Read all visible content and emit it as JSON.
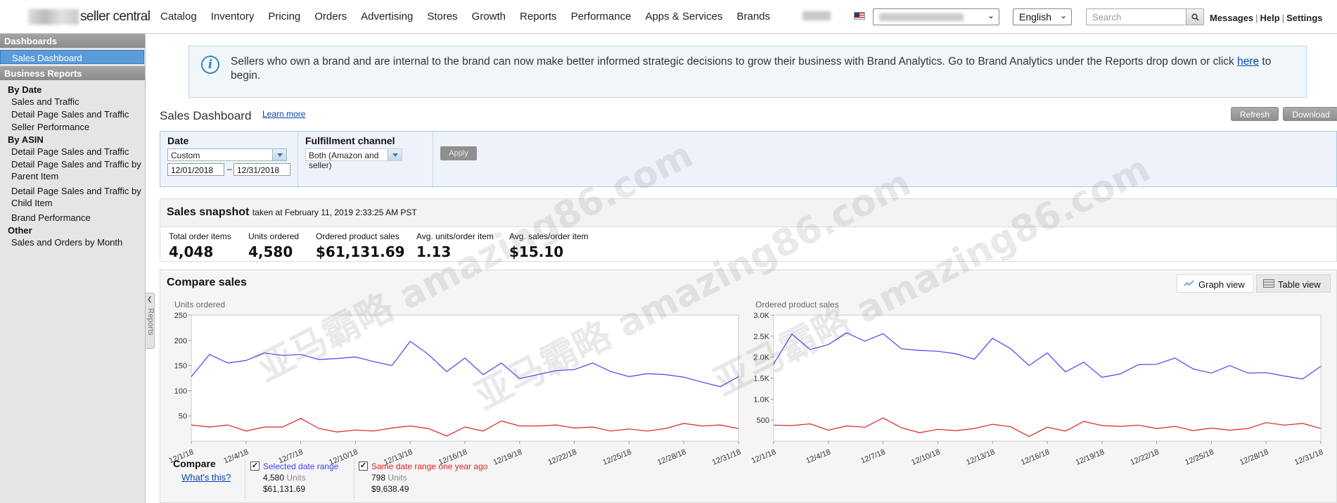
{
  "header": {
    "logo_text": "seller central",
    "nav": [
      "Catalog",
      "Inventory",
      "Pricing",
      "Orders",
      "Advertising",
      "Stores",
      "Growth",
      "Reports",
      "Performance",
      "Apps & Services",
      "Brands"
    ],
    "language": "English",
    "search_placeholder": "Search",
    "links": [
      "Messages",
      "Help",
      "Settings"
    ]
  },
  "sidebar": {
    "dashboards_heading": "Dashboards",
    "active_item": "Sales Dashboard",
    "reports_heading": "Business Reports",
    "groups": [
      {
        "title": "By Date",
        "items": [
          "Sales and Traffic",
          "Detail Page Sales and Traffic",
          "Seller Performance"
        ]
      },
      {
        "title": "By ASIN",
        "items": [
          "Detail Page Sales and Traffic",
          "Detail Page Sales and Traffic by Parent Item",
          "Detail Page Sales and Traffic by Child Item",
          "Brand Performance"
        ]
      },
      {
        "title": "Other",
        "items": [
          "Sales and Orders by Month"
        ]
      }
    ],
    "reports_tab": "Reports"
  },
  "banner": {
    "text": "Sellers who own a brand and are internal to the brand can now make better informed strategic decisions to grow their business with Brand Analytics. Go to Brand Analytics under the Reports drop down or click ",
    "link": "here",
    "text_end": " to begin."
  },
  "dashboard": {
    "title": "Sales Dashboard",
    "learn_more": "Learn more",
    "refresh": "Refresh",
    "download": "Download"
  },
  "filters": {
    "date_label": "Date",
    "date_range": "Custom",
    "date_from": "12/01/2018",
    "date_sep": "–",
    "date_to": "12/31/2018",
    "channel_label": "Fulfillment channel",
    "channel_value": "Both (Amazon and seller)",
    "apply": "Apply"
  },
  "snapshot": {
    "title": "Sales snapshot",
    "taken": "taken at February 11, 2019 2:33:25 AM PST",
    "metrics": [
      {
        "label": "Total order items",
        "value": "4,048"
      },
      {
        "label": "Units ordered",
        "value": "4,580"
      },
      {
        "label": "Ordered product sales",
        "value": "$61,131.69"
      },
      {
        "label": "Avg. units/order item",
        "value": "1.13"
      },
      {
        "label": "Avg. sales/order item",
        "value": "$15.10"
      }
    ]
  },
  "compare": {
    "title": "Compare sales",
    "graph_view": "Graph view",
    "table_view": "Table view",
    "compare_label": "Compare",
    "whats_this": "What's this?",
    "selected": {
      "label": "Selected date range",
      "units": "4,580",
      "units_word": "Units",
      "sales": "$61,131.69"
    },
    "last_year": {
      "label": "Same date range one year ago",
      "units": "798",
      "units_word": "Units",
      "sales": "$9,638.49"
    }
  },
  "colors": {
    "selected": "#4444ee",
    "last_year": "#dd2222"
  },
  "chart_data": [
    {
      "type": "line",
      "title": "Units ordered",
      "x": [
        "12/1/18",
        "12/2/18",
        "12/3/18",
        "12/4/18",
        "12/5/18",
        "12/6/18",
        "12/7/18",
        "12/8/18",
        "12/9/18",
        "12/10/18",
        "12/11/18",
        "12/12/18",
        "12/13/18",
        "12/14/18",
        "12/15/18",
        "12/16/18",
        "12/17/18",
        "12/18/18",
        "12/19/18",
        "12/20/18",
        "12/21/18",
        "12/22/18",
        "12/23/18",
        "12/24/18",
        "12/25/18",
        "12/26/18",
        "12/27/18",
        "12/28/18",
        "12/29/18",
        "12/30/18",
        "12/31/18"
      ],
      "tick_labels": [
        "12/1/18",
        "12/4/18",
        "12/7/18",
        "12/10/18",
        "12/13/18",
        "12/16/18",
        "12/19/18",
        "12/22/18",
        "12/25/18",
        "12/28/18",
        "12/31/18"
      ],
      "ylim": [
        0,
        250
      ],
      "yticks": [
        50,
        100,
        150,
        200,
        250
      ],
      "series": [
        {
          "name": "Selected date range",
          "values": [
            128,
            172,
            155,
            160,
            175,
            170,
            172,
            162,
            164,
            167,
            158,
            150,
            198,
            172,
            138,
            165,
            132,
            155,
            124,
            132,
            140,
            142,
            155,
            138,
            128,
            134,
            132,
            127,
            117,
            108,
            128
          ]
        },
        {
          "name": "Same date range one year ago",
          "values": [
            32,
            28,
            32,
            20,
            28,
            28,
            45,
            25,
            18,
            22,
            20,
            26,
            30,
            25,
            10,
            28,
            20,
            40,
            30,
            30,
            32,
            26,
            28,
            20,
            24,
            20,
            25,
            35,
            30,
            32,
            25
          ]
        }
      ]
    },
    {
      "type": "line",
      "title": "Ordered product sales",
      "x": [
        "12/1/18",
        "12/2/18",
        "12/3/18",
        "12/4/18",
        "12/5/18",
        "12/6/18",
        "12/7/18",
        "12/8/18",
        "12/9/18",
        "12/10/18",
        "12/11/18",
        "12/12/18",
        "12/13/18",
        "12/14/18",
        "12/15/18",
        "12/16/18",
        "12/17/18",
        "12/18/18",
        "12/19/18",
        "12/20/18",
        "12/21/18",
        "12/22/18",
        "12/23/18",
        "12/24/18",
        "12/25/18",
        "12/26/18",
        "12/27/18",
        "12/28/18",
        "12/29/18",
        "12/30/18",
        "12/31/18"
      ],
      "tick_labels": [
        "12/1/18",
        "12/4/18",
        "12/7/18",
        "12/10/18",
        "12/13/18",
        "12/16/18",
        "12/19/18",
        "12/22/18",
        "12/25/18",
        "12/28/18",
        "12/31/18"
      ],
      "ylim": [
        0,
        3000
      ],
      "yticks": [
        500,
        1000,
        1500,
        2000,
        2500,
        3000
      ],
      "ytick_labels": [
        "500",
        "1.0K",
        "1.5K",
        "2.0K",
        "2.5K",
        "3.0K"
      ],
      "series": [
        {
          "name": "Selected date range",
          "values": [
            1840,
            2550,
            2180,
            2300,
            2580,
            2380,
            2560,
            2200,
            2160,
            2140,
            2080,
            1950,
            2450,
            2200,
            1800,
            2100,
            1650,
            1880,
            1520,
            1600,
            1820,
            1830,
            1980,
            1720,
            1620,
            1800,
            1620,
            1630,
            1550,
            1480,
            1780
          ]
        },
        {
          "name": "Same date range one year ago",
          "values": [
            380,
            370,
            410,
            260,
            360,
            330,
            550,
            320,
            200,
            280,
            250,
            300,
            400,
            340,
            110,
            330,
            240,
            470,
            370,
            350,
            380,
            300,
            350,
            250,
            310,
            260,
            300,
            440,
            380,
            420,
            300
          ]
        }
      ]
    }
  ]
}
